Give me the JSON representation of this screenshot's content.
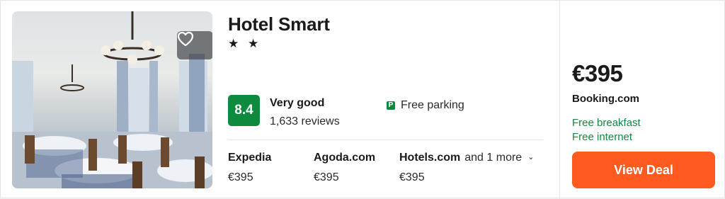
{
  "hotel": {
    "name": "Hotel Smart",
    "stars_text": "★ ★",
    "rating": {
      "score": "8.4",
      "label": "Very good",
      "reviews": "1,633 reviews"
    },
    "amenity": {
      "icon": "parking-icon",
      "text": "Free parking"
    }
  },
  "providers": [
    {
      "name": "Expedia",
      "price": "€395"
    },
    {
      "name": "Agoda.com",
      "price": "€395"
    },
    {
      "name": "Hotels.com",
      "price": "€395",
      "more": "and 1 more"
    }
  ],
  "deal": {
    "price": "€395",
    "site": "Booking.com",
    "perks": [
      "Free breakfast",
      "Free internet"
    ],
    "button": "View Deal"
  },
  "colors": {
    "rating_green": "#0e8a3e",
    "deal_orange": "#ff5a1f",
    "perk_green": "#0e8a3e"
  }
}
